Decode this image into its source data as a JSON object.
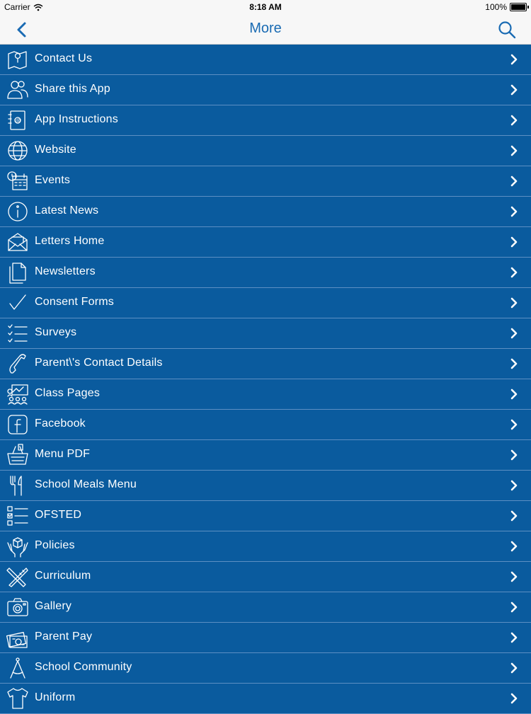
{
  "status_bar": {
    "carrier": "Carrier",
    "time": "8:18 AM",
    "battery": "100%"
  },
  "nav": {
    "title": "More",
    "back_icon": "chevron-left-icon",
    "search_icon": "search-icon"
  },
  "menu": [
    {
      "label": "Contact Us",
      "icon": "map-pin-icon"
    },
    {
      "label": "Share this App",
      "icon": "users-icon"
    },
    {
      "label": "App Instructions",
      "icon": "address-book-icon"
    },
    {
      "label": "Website",
      "icon": "globe-icon"
    },
    {
      "label": "Events",
      "icon": "calendar-clock-icon"
    },
    {
      "label": "Latest News",
      "icon": "info-icon"
    },
    {
      "label": "Letters Home",
      "icon": "envelope-open-icon"
    },
    {
      "label": "Newsletters",
      "icon": "documents-icon"
    },
    {
      "label": "Consent Forms",
      "icon": "checkmark-icon"
    },
    {
      "label": "Surveys",
      "icon": "checklist-icon"
    },
    {
      "label": "Parent\\'s Contact Details",
      "icon": "phone-handset-icon"
    },
    {
      "label": "Class Pages",
      "icon": "classroom-icon"
    },
    {
      "label": "Facebook",
      "icon": "facebook-icon"
    },
    {
      "label": "Menu PDF",
      "icon": "basket-icon"
    },
    {
      "label": "School Meals Menu",
      "icon": "cutlery-icon"
    },
    {
      "label": "OFSTED",
      "icon": "checkbox-list-icon"
    },
    {
      "label": "Policies",
      "icon": "hands-box-icon"
    },
    {
      "label": "Curriculum",
      "icon": "pencil-ruler-icon"
    },
    {
      "label": "Gallery",
      "icon": "camera-icon"
    },
    {
      "label": "Parent Pay",
      "icon": "money-icon"
    },
    {
      "label": "School Community",
      "icon": "compass-icon"
    },
    {
      "label": "Uniform",
      "icon": "tshirt-icon"
    }
  ],
  "colors": {
    "row_bg": "#0a5b9e",
    "row_divider": "#5c8fc3",
    "accent": "#1a6bb3",
    "bar_bg": "#f7f7f7"
  }
}
